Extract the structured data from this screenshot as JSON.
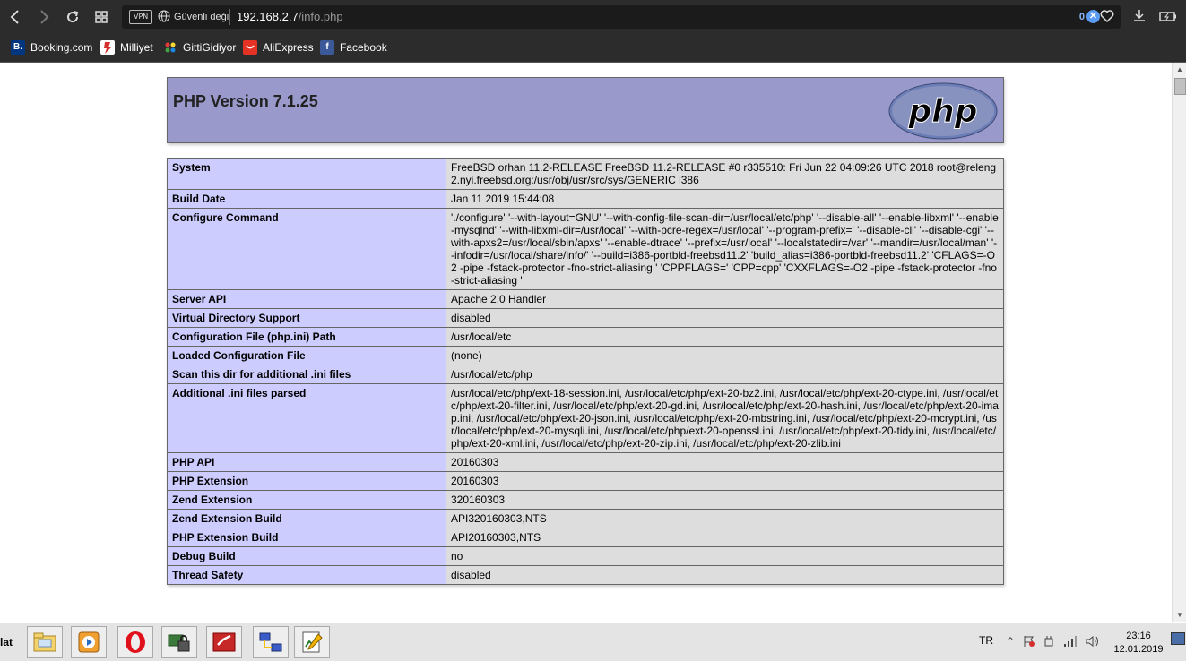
{
  "browser": {
    "vpn_label": "VPN",
    "security_text": "Güvenli değil",
    "url_host": "192.168.2.7",
    "url_path": "/info.php",
    "adblock_count": "0"
  },
  "bookmarks": [
    {
      "label": "Booking.com",
      "icon": "booking-icon",
      "color": "#003580",
      "glyph": "B."
    },
    {
      "label": "Milliyet",
      "icon": "milliyet-icon",
      "color": "#ffffff",
      "glyph": ""
    },
    {
      "label": "GittiGidiyor",
      "icon": "gittigidiyor-icon",
      "color": "#2c2c2c",
      "glyph": ""
    },
    {
      "label": "AliExpress",
      "icon": "aliexpress-icon",
      "color": "#e43225",
      "glyph": ""
    },
    {
      "label": "Facebook",
      "icon": "facebook-icon",
      "color": "#3b5998",
      "glyph": "f"
    }
  ],
  "page": {
    "title": "PHP Version 7.1.25",
    "logo_text": "php",
    "rows": [
      {
        "key": "System",
        "value": "FreeBSD orhan 11.2-RELEASE FreeBSD 11.2-RELEASE #0 r335510: Fri Jun 22 04:09:26 UTC 2018 root@releng2.nyi.freebsd.org:/usr/obj/usr/src/sys/GENERIC i386"
      },
      {
        "key": "Build Date",
        "value": "Jan 11 2019 15:44:08"
      },
      {
        "key": "Configure Command",
        "value": "'./configure' '--with-layout=GNU' '--with-config-file-scan-dir=/usr/local/etc/php' '--disable-all' '--enable-libxml' '--enable-mysqlnd' '--with-libxml-dir=/usr/local' '--with-pcre-regex=/usr/local' '--program-prefix=' '--disable-cli' '--disable-cgi' '--with-apxs2=/usr/local/sbin/apxs' '--enable-dtrace' '--prefix=/usr/local' '--localstatedir=/var' '--mandir=/usr/local/man' '--infodir=/usr/local/share/info/' '--build=i386-portbld-freebsd11.2' 'build_alias=i386-portbld-freebsd11.2' 'CFLAGS=-O2 -pipe -fstack-protector -fno-strict-aliasing ' 'CPPFLAGS=' 'CPP=cpp' 'CXXFLAGS=-O2 -pipe -fstack-protector -fno-strict-aliasing '"
      },
      {
        "key": "Server API",
        "value": "Apache 2.0 Handler"
      },
      {
        "key": "Virtual Directory Support",
        "value": "disabled"
      },
      {
        "key": "Configuration File (php.ini) Path",
        "value": "/usr/local/etc"
      },
      {
        "key": "Loaded Configuration File",
        "value": "(none)"
      },
      {
        "key": "Scan this dir for additional .ini files",
        "value": "/usr/local/etc/php"
      },
      {
        "key": "Additional .ini files parsed",
        "value": "/usr/local/etc/php/ext-18-session.ini, /usr/local/etc/php/ext-20-bz2.ini, /usr/local/etc/php/ext-20-ctype.ini, /usr/local/etc/php/ext-20-filter.ini, /usr/local/etc/php/ext-20-gd.ini, /usr/local/etc/php/ext-20-hash.ini, /usr/local/etc/php/ext-20-imap.ini, /usr/local/etc/php/ext-20-json.ini, /usr/local/etc/php/ext-20-mbstring.ini, /usr/local/etc/php/ext-20-mcrypt.ini, /usr/local/etc/php/ext-20-mysqli.ini, /usr/local/etc/php/ext-20-openssl.ini, /usr/local/etc/php/ext-20-tidy.ini, /usr/local/etc/php/ext-20-xml.ini, /usr/local/etc/php/ext-20-zip.ini, /usr/local/etc/php/ext-20-zlib.ini"
      },
      {
        "key": "PHP API",
        "value": "20160303"
      },
      {
        "key": "PHP Extension",
        "value": "20160303"
      },
      {
        "key": "Zend Extension",
        "value": "320160303"
      },
      {
        "key": "Zend Extension Build",
        "value": "API320160303,NTS"
      },
      {
        "key": "PHP Extension Build",
        "value": "API20160303,NTS"
      },
      {
        "key": "Debug Build",
        "value": "no"
      },
      {
        "key": "Thread Safety",
        "value": "disabled"
      }
    ]
  },
  "colors": {
    "header_bg": "#9999cc",
    "key_bg": "#ccccff",
    "value_bg": "#dddddd"
  },
  "taskbar": {
    "start_fragment": "lat",
    "language": "TR",
    "time": "23:16",
    "date": "12.01.2019",
    "apps": [
      "file-manager-icon",
      "media-player-icon",
      "opera-icon",
      "network-lock-icon",
      "red-app-icon",
      "network-tool-icon",
      "text-editor-icon"
    ]
  }
}
